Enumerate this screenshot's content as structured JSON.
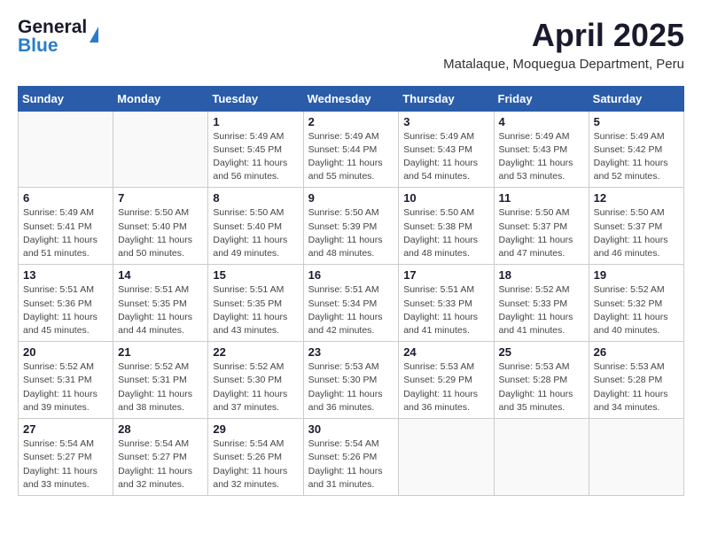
{
  "header": {
    "logo_general": "General",
    "logo_blue": "Blue",
    "month_title": "April 2025",
    "subtitle": "Matalaque, Moquegua Department, Peru"
  },
  "weekdays": [
    "Sunday",
    "Monday",
    "Tuesday",
    "Wednesday",
    "Thursday",
    "Friday",
    "Saturday"
  ],
  "weeks": [
    [
      {
        "day": "",
        "info": ""
      },
      {
        "day": "",
        "info": ""
      },
      {
        "day": "1",
        "info": "Sunrise: 5:49 AM\nSunset: 5:45 PM\nDaylight: 11 hours and 56 minutes."
      },
      {
        "day": "2",
        "info": "Sunrise: 5:49 AM\nSunset: 5:44 PM\nDaylight: 11 hours and 55 minutes."
      },
      {
        "day": "3",
        "info": "Sunrise: 5:49 AM\nSunset: 5:43 PM\nDaylight: 11 hours and 54 minutes."
      },
      {
        "day": "4",
        "info": "Sunrise: 5:49 AM\nSunset: 5:43 PM\nDaylight: 11 hours and 53 minutes."
      },
      {
        "day": "5",
        "info": "Sunrise: 5:49 AM\nSunset: 5:42 PM\nDaylight: 11 hours and 52 minutes."
      }
    ],
    [
      {
        "day": "6",
        "info": "Sunrise: 5:49 AM\nSunset: 5:41 PM\nDaylight: 11 hours and 51 minutes."
      },
      {
        "day": "7",
        "info": "Sunrise: 5:50 AM\nSunset: 5:40 PM\nDaylight: 11 hours and 50 minutes."
      },
      {
        "day": "8",
        "info": "Sunrise: 5:50 AM\nSunset: 5:40 PM\nDaylight: 11 hours and 49 minutes."
      },
      {
        "day": "9",
        "info": "Sunrise: 5:50 AM\nSunset: 5:39 PM\nDaylight: 11 hours and 48 minutes."
      },
      {
        "day": "10",
        "info": "Sunrise: 5:50 AM\nSunset: 5:38 PM\nDaylight: 11 hours and 48 minutes."
      },
      {
        "day": "11",
        "info": "Sunrise: 5:50 AM\nSunset: 5:37 PM\nDaylight: 11 hours and 47 minutes."
      },
      {
        "day": "12",
        "info": "Sunrise: 5:50 AM\nSunset: 5:37 PM\nDaylight: 11 hours and 46 minutes."
      }
    ],
    [
      {
        "day": "13",
        "info": "Sunrise: 5:51 AM\nSunset: 5:36 PM\nDaylight: 11 hours and 45 minutes."
      },
      {
        "day": "14",
        "info": "Sunrise: 5:51 AM\nSunset: 5:35 PM\nDaylight: 11 hours and 44 minutes."
      },
      {
        "day": "15",
        "info": "Sunrise: 5:51 AM\nSunset: 5:35 PM\nDaylight: 11 hours and 43 minutes."
      },
      {
        "day": "16",
        "info": "Sunrise: 5:51 AM\nSunset: 5:34 PM\nDaylight: 11 hours and 42 minutes."
      },
      {
        "day": "17",
        "info": "Sunrise: 5:51 AM\nSunset: 5:33 PM\nDaylight: 11 hours and 41 minutes."
      },
      {
        "day": "18",
        "info": "Sunrise: 5:52 AM\nSunset: 5:33 PM\nDaylight: 11 hours and 41 minutes."
      },
      {
        "day": "19",
        "info": "Sunrise: 5:52 AM\nSunset: 5:32 PM\nDaylight: 11 hours and 40 minutes."
      }
    ],
    [
      {
        "day": "20",
        "info": "Sunrise: 5:52 AM\nSunset: 5:31 PM\nDaylight: 11 hours and 39 minutes."
      },
      {
        "day": "21",
        "info": "Sunrise: 5:52 AM\nSunset: 5:31 PM\nDaylight: 11 hours and 38 minutes."
      },
      {
        "day": "22",
        "info": "Sunrise: 5:52 AM\nSunset: 5:30 PM\nDaylight: 11 hours and 37 minutes."
      },
      {
        "day": "23",
        "info": "Sunrise: 5:53 AM\nSunset: 5:30 PM\nDaylight: 11 hours and 36 minutes."
      },
      {
        "day": "24",
        "info": "Sunrise: 5:53 AM\nSunset: 5:29 PM\nDaylight: 11 hours and 36 minutes."
      },
      {
        "day": "25",
        "info": "Sunrise: 5:53 AM\nSunset: 5:28 PM\nDaylight: 11 hours and 35 minutes."
      },
      {
        "day": "26",
        "info": "Sunrise: 5:53 AM\nSunset: 5:28 PM\nDaylight: 11 hours and 34 minutes."
      }
    ],
    [
      {
        "day": "27",
        "info": "Sunrise: 5:54 AM\nSunset: 5:27 PM\nDaylight: 11 hours and 33 minutes."
      },
      {
        "day": "28",
        "info": "Sunrise: 5:54 AM\nSunset: 5:27 PM\nDaylight: 11 hours and 32 minutes."
      },
      {
        "day": "29",
        "info": "Sunrise: 5:54 AM\nSunset: 5:26 PM\nDaylight: 11 hours and 32 minutes."
      },
      {
        "day": "30",
        "info": "Sunrise: 5:54 AM\nSunset: 5:26 PM\nDaylight: 11 hours and 31 minutes."
      },
      {
        "day": "",
        "info": ""
      },
      {
        "day": "",
        "info": ""
      },
      {
        "day": "",
        "info": ""
      }
    ]
  ]
}
